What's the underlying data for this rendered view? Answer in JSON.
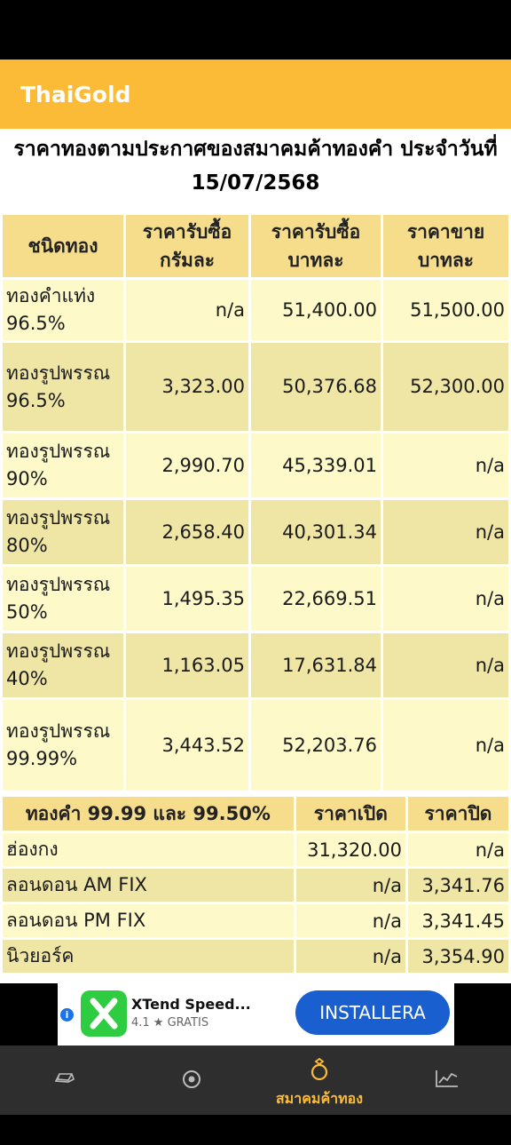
{
  "app": {
    "title": "ThaiGold"
  },
  "page_title": "ราคาทองตามประกาศของสมาคมค้าทองคำ ประจำวันที่ 15/07/2568",
  "gold_table": {
    "headers": [
      "ชนิดทอง",
      "ราคารับซื้อ กรัมละ",
      "ราคารับซื้อ บาทละ",
      "ราคาขาย บาทละ"
    ],
    "rows": [
      {
        "type": "ทองคำแท่ง 96.5%",
        "buy_gram": "n/a",
        "buy_baht": "51,400.00",
        "sell_baht": "51,500.00"
      },
      {
        "type": "ทองรูปพรรณ 96.5%",
        "buy_gram": "3,323.00",
        "buy_baht": "50,376.68",
        "sell_baht": "52,300.00"
      },
      {
        "type": "ทองรูปพรรณ 90%",
        "buy_gram": "2,990.70",
        "buy_baht": "45,339.01",
        "sell_baht": "n/a"
      },
      {
        "type": "ทองรูปพรรณ 80%",
        "buy_gram": "2,658.40",
        "buy_baht": "40,301.34",
        "sell_baht": "n/a"
      },
      {
        "type": "ทองรูปพรรณ 50%",
        "buy_gram": "1,495.35",
        "buy_baht": "22,669.51",
        "sell_baht": "n/a"
      },
      {
        "type": "ทองรูปพรรณ 40%",
        "buy_gram": "1,163.05",
        "buy_baht": "17,631.84",
        "sell_baht": "n/a"
      },
      {
        "type": "ทองรูปพรรณ 99.99%",
        "buy_gram": "3,443.52",
        "buy_baht": "52,203.76",
        "sell_baht": "n/a"
      }
    ]
  },
  "world_table": {
    "headers": [
      "ทองคำ 99.99 และ 99.50%",
      "ราคาเปิด",
      "ราคาปิด"
    ],
    "rows": [
      {
        "market": "ฮ่องกง",
        "open": "31,320.00",
        "close": "n/a"
      },
      {
        "market": "ลอนดอน AM FIX",
        "open": "n/a",
        "close": "3,341.76"
      },
      {
        "market": "ลอนดอน PM FIX",
        "open": "n/a",
        "close": "3,341.45"
      },
      {
        "market": "นิวยอร์ค",
        "open": "n/a",
        "close": "3,354.90"
      }
    ]
  },
  "ad": {
    "app_name": "XTend Speed...",
    "rating": "4.1 ★ GRATIS",
    "install_label": "INSTALLERA",
    "info_icon": "info-icon"
  },
  "bottom_nav": {
    "items": [
      {
        "icon": "gold-bar-icon",
        "label": ""
      },
      {
        "icon": "target-icon",
        "label": ""
      },
      {
        "icon": "ring-icon",
        "label": "สมาคมค้าทอง"
      },
      {
        "icon": "chart-icon",
        "label": ""
      }
    ],
    "active_color": "#fcbb37"
  },
  "colors": {
    "accent": "#fcbb37",
    "header_cell": "#f6dd8c",
    "row_light": "#fdf9c9",
    "row_dark": "#efe6a6"
  }
}
